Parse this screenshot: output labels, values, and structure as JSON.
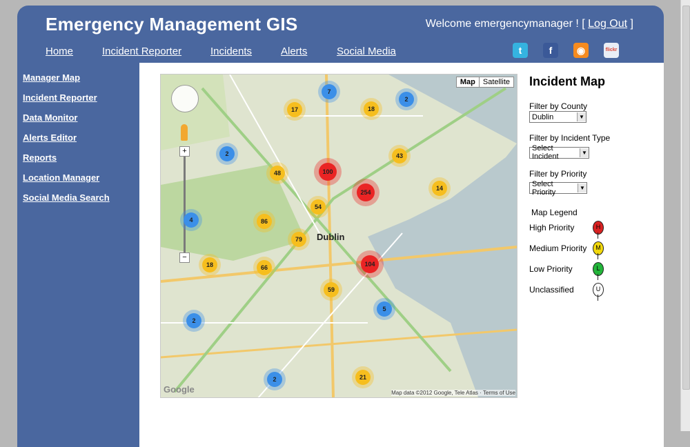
{
  "header": {
    "title": "Emergency Management GIS",
    "welcome_text": "Welcome emergencymanager ! [",
    "logout_label": "Log Out",
    "welcome_close": "]"
  },
  "topnav": [
    "Home",
    "Incident Reporter",
    "Incidents",
    "Alerts",
    "Social Media"
  ],
  "social_icons": [
    {
      "name": "twitter-icon",
      "glyph": "t",
      "color": "#35b3e0"
    },
    {
      "name": "facebook-icon",
      "glyph": "f",
      "color": "#3b5998"
    },
    {
      "name": "rss-icon",
      "glyph": "◉",
      "color": "#f68b1f"
    },
    {
      "name": "flickr-icon",
      "glyph": "flickr",
      "color": "#e9eef6"
    }
  ],
  "sidebar": [
    "Manager Map",
    "Incident Reporter",
    "Data Monitor",
    "Alerts Editor",
    "Reports",
    "Location Manager",
    "Social Media Search"
  ],
  "map": {
    "type_buttons": [
      "Map",
      "Satellite"
    ],
    "attribution": "Map data ©2012 Google, Tele Atlas · Terms of Use",
    "google_logo": "Google",
    "city_label": "Dublin",
    "clusters": [
      "7",
      "2",
      "17",
      "18",
      "2",
      "43",
      "100",
      "48",
      "254",
      "14",
      "54",
      "4",
      "86",
      "79",
      "104",
      "18",
      "66",
      "59",
      "5",
      "2",
      "2",
      "21"
    ]
  },
  "panel": {
    "title": "Incident Map",
    "county_label": "Filter by County",
    "county_value": "Dublin",
    "type_label": "Filter by Incident Type",
    "type_value": "Select Incident",
    "priority_label": "Filter by Priority",
    "priority_value": "Select Priority",
    "legend_title": "Map Legend",
    "legend": [
      {
        "label": "High Priority",
        "letter": "H",
        "color": "#d92222"
      },
      {
        "label": "Medium Priority",
        "letter": "M",
        "color": "#f2d80c"
      },
      {
        "label": "Low Priority",
        "letter": "L",
        "color": "#23b53a"
      },
      {
        "label": "Unclassified",
        "letter": "U",
        "color": "#ffffff"
      }
    ]
  }
}
